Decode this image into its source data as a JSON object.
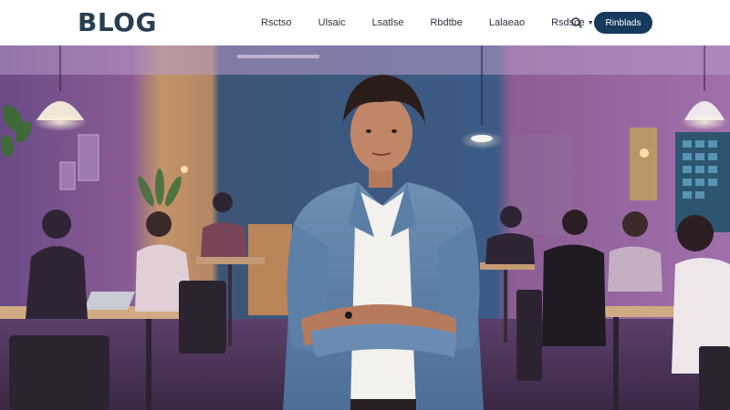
{
  "header": {
    "logo": "BLOG",
    "nav": [
      {
        "label": "Rsctso",
        "has_dropdown": false
      },
      {
        "label": "Ulsaic",
        "has_dropdown": false
      },
      {
        "label": "Lsatlse",
        "has_dropdown": false
      },
      {
        "label": "Rbdtbe",
        "has_dropdown": false
      },
      {
        "label": "Lalaeao",
        "has_dropdown": false
      },
      {
        "label": "Rsdsce",
        "has_dropdown": true
      }
    ],
    "search_icon": "search-icon",
    "cta_label": "Rinblads"
  },
  "hero": {
    "image": "photo of a young man in a denim jacket standing with crossed arms in a purple-lit coworking cafe"
  },
  "colors": {
    "logo": "#2a3e52",
    "cta_bg": "#163a5c",
    "nav_text": "#2c3440"
  }
}
